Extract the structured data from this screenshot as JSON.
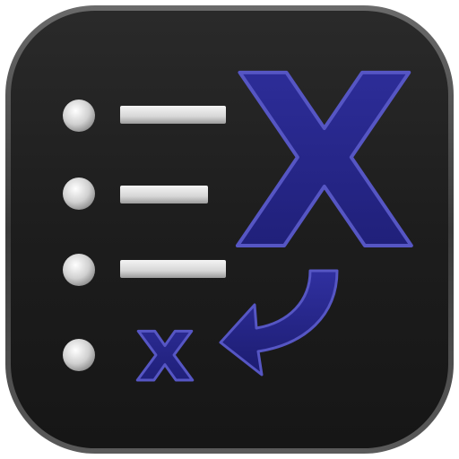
{
  "icon": {
    "big_letter": "X",
    "small_letter": "x",
    "list_rows": 4,
    "colors": {
      "tile": "#1c1c1c",
      "tile_edge": "#3a3a3a",
      "bullet": "#d8d8d8",
      "bar": "#e0e0e0",
      "letter_fill": "#252585",
      "letter_stroke": "#4a4ab8",
      "arrow_fill": "#252585"
    },
    "glyphs": [
      "list-icon",
      "big-x-letter",
      "small-x-letter",
      "curved-arrow-icon"
    ]
  }
}
